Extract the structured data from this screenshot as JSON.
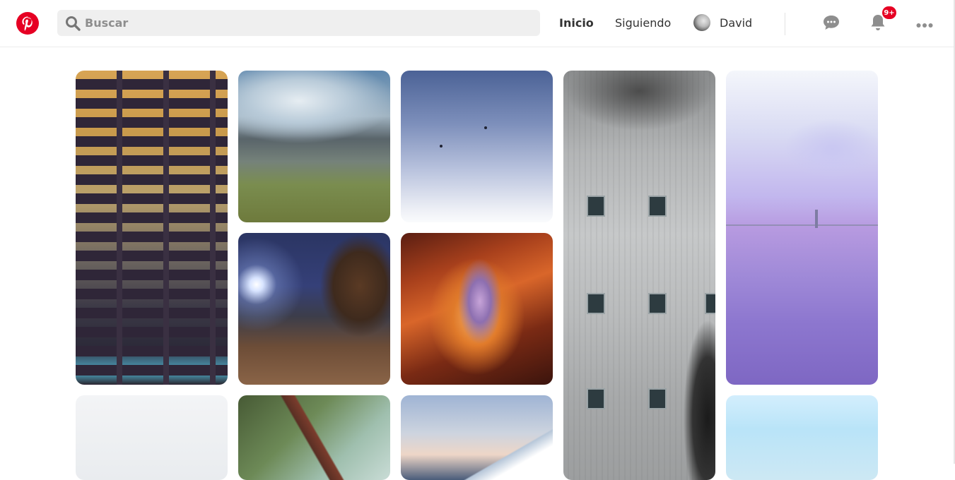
{
  "header": {
    "logo_icon": "pinterest-logo-icon",
    "brand_color": "#e60023",
    "search": {
      "placeholder": "Buscar",
      "icon": "search-icon"
    },
    "nav": {
      "home_label": "Inicio",
      "following_label": "Siguiendo"
    },
    "profile": {
      "name": "David",
      "avatar_icon": "avatar-icon"
    },
    "messages_icon": "chat-bubble-icon",
    "notifications": {
      "icon": "bell-icon",
      "badge": "9+"
    },
    "more_icon": "more-dots-icon"
  },
  "feed": {
    "pins": [
      {
        "subject": "building-windows-night",
        "column": 1
      },
      {
        "subject": "misty-mountain-valley",
        "column": 2
      },
      {
        "subject": "birds-in-sky",
        "column": 3
      },
      {
        "subject": "weathered-wall-windows",
        "column": 4
      },
      {
        "subject": "purple-sea-bridge",
        "column": 5
      },
      {
        "subject": "balanced-rock-night",
        "column": 2
      },
      {
        "subject": "antelope-canyon",
        "column": 3
      },
      {
        "subject": "foggy-white",
        "column": 1
      },
      {
        "subject": "forest-train-window",
        "column": 2
      },
      {
        "subject": "snowy-mountain-peak",
        "column": 3
      },
      {
        "subject": "blue-sky-clouds",
        "column": 5
      }
    ]
  }
}
